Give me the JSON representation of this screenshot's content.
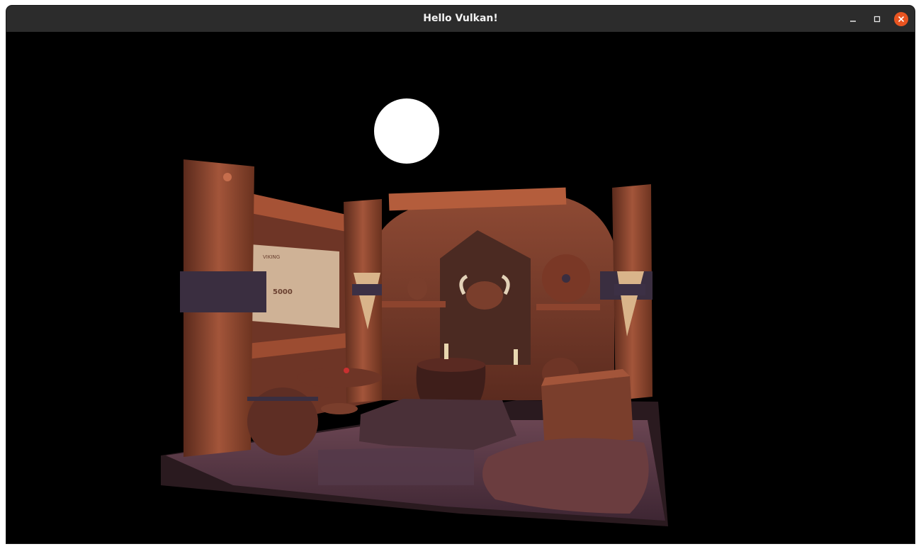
{
  "window": {
    "title": "Hello Vulkan!",
    "controls": {
      "minimize": "minimize-icon",
      "maximize": "maximize-icon",
      "close": "close-icon"
    },
    "close_color": "#e95420"
  },
  "scene": {
    "poster_text": "5000",
    "poster_heading": "VIKING",
    "background": "#000000",
    "light_color": "#ffffff"
  }
}
